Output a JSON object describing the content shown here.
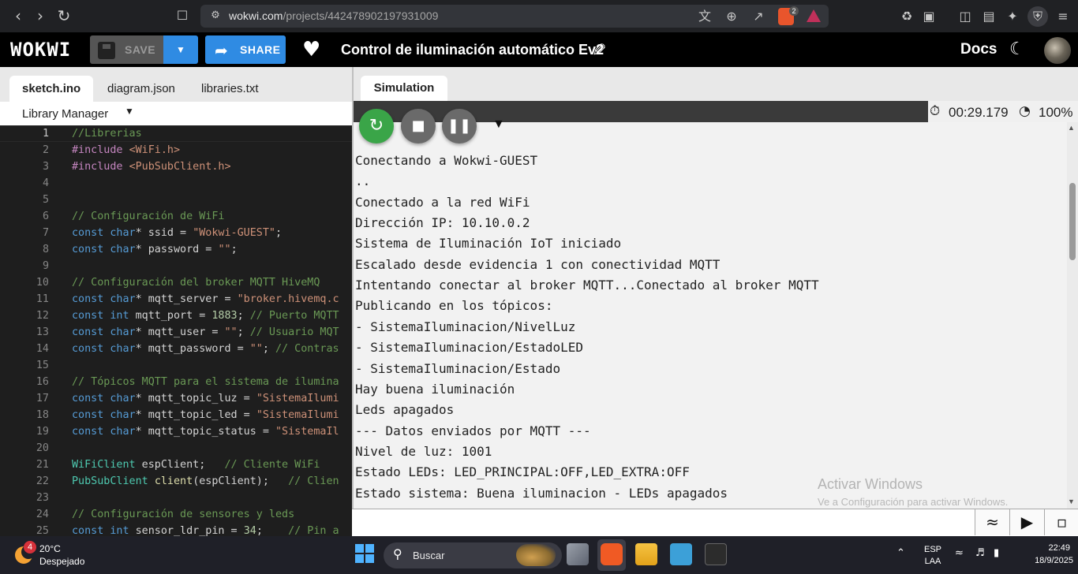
{
  "browser": {
    "url_domain": "wokwi.com",
    "url_path": "/projects/442478902197931009",
    "brave_badge": "2"
  },
  "header": {
    "logo": "WOKWI",
    "save_label": "SAVE",
    "share_label": "SHARE",
    "project_title": "Control de iluminación automático Ev2",
    "docs_label": "Docs"
  },
  "editor_tabs": [
    "sketch.ino",
    "diagram.json",
    "libraries.txt"
  ],
  "library_manager_label": "Library Manager",
  "code_lines": [
    {
      "n": "1",
      "html": "<span class='cm'>//Librerias</span>"
    },
    {
      "n": "2",
      "html": "<span class='inc'>#include</span> <span class='st'>&lt;WiFi.h&gt;</span>"
    },
    {
      "n": "3",
      "html": "<span class='inc'>#include</span> <span class='st'>&lt;PubSubClient.h&gt;</span>"
    },
    {
      "n": "4",
      "html": ""
    },
    {
      "n": "5",
      "html": ""
    },
    {
      "n": "6",
      "html": "<span class='cm'>// Configuración de WiFi</span>"
    },
    {
      "n": "7",
      "html": "<span class='kw'>const</span> <span class='kw'>char</span>* ssid = <span class='st'>\"Wokwi-GUEST\"</span>;"
    },
    {
      "n": "8",
      "html": "<span class='kw'>const</span> <span class='kw'>char</span>* password = <span class='st'>\"\"</span>;"
    },
    {
      "n": "9",
      "html": ""
    },
    {
      "n": "10",
      "html": "<span class='cm'>// Configuración del broker MQTT HiveMQ</span>"
    },
    {
      "n": "11",
      "html": "<span class='kw'>const</span> <span class='kw'>char</span>* mqtt_server = <span class='st'>\"broker.hivemq.c</span>"
    },
    {
      "n": "12",
      "html": "<span class='kw'>const</span> <span class='kw'>int</span> mqtt_port = <span class='nm'>1883</span>; <span class='cm'>// Puerto MQTT</span>"
    },
    {
      "n": "13",
      "html": "<span class='kw'>const</span> <span class='kw'>char</span>* mqtt_user = <span class='st'>\"\"</span>; <span class='cm'>// Usuario MQT</span>"
    },
    {
      "n": "14",
      "html": "<span class='kw'>const</span> <span class='kw'>char</span>* mqtt_password = <span class='st'>\"\"</span>; <span class='cm'>// Contras</span>"
    },
    {
      "n": "15",
      "html": ""
    },
    {
      "n": "16",
      "html": "<span class='cm'>// Tópicos MQTT para el sistema de ilumina</span>"
    },
    {
      "n": "17",
      "html": "<span class='kw'>const</span> <span class='kw'>char</span>* mqtt_topic_luz = <span class='st'>\"SistemaIlumi</span>"
    },
    {
      "n": "18",
      "html": "<span class='kw'>const</span> <span class='kw'>char</span>* mqtt_topic_led = <span class='st'>\"SistemaIlumi</span>"
    },
    {
      "n": "19",
      "html": "<span class='kw'>const</span> <span class='kw'>char</span>* mqtt_topic_status = <span class='st'>\"SistemaIl</span>"
    },
    {
      "n": "20",
      "html": ""
    },
    {
      "n": "21",
      "html": "<span class='ty'>WiFiClient</span> espClient;   <span class='cm'>// Cliente WiFi</span>"
    },
    {
      "n": "22",
      "html": "<span class='ty'>PubSubClient</span> <span class='fn'>client</span>(espClient);   <span class='cm'>// Clien</span>"
    },
    {
      "n": "23",
      "html": ""
    },
    {
      "n": "24",
      "html": "<span class='cm'>// Configuración de sensores y leds</span>"
    },
    {
      "n": "25",
      "html": "<span class='kw'>const</span> <span class='kw'>int</span> sensor_ldr_pin = <span class='nm'>34</span>;    <span class='cm'>// Pin a</span>"
    }
  ],
  "simulation": {
    "tab_label": "Simulation",
    "timer": "00:29.179",
    "speed": "100%",
    "serial_lines": [
      "Conectando a Wokwi-GUEST",
      "..",
      "Conectado a la red WiFi",
      "Dirección IP: 10.10.0.2",
      "Sistema de Iluminación IoT iniciado",
      "Escalado desde evidencia 1 con conectividad MQTT",
      "Intentando conectar al broker MQTT...Conectado al broker MQTT",
      "Publicando en los tópicos:",
      "- SistemaIluminacion/NivelLuz",
      "- SistemaIluminacion/EstadoLED",
      "- SistemaIluminacion/Estado",
      "Hay buena iluminación",
      "Leds apagados",
      "--- Datos enviados por MQTT ---",
      "Nivel de luz: 1001",
      "Estado LEDs: LED_PRINCIPAL:OFF,LED_EXTRA:OFF",
      "Estado sistema: Buena iluminacion - LEDs apagados"
    ],
    "serial_input_value": ""
  },
  "watermark": {
    "line1": "Activar Windows",
    "line2": "Ve a Configuración para activar Windows."
  },
  "taskbar": {
    "weather_badge": "4",
    "weather_temp": "20°C",
    "weather_desc": "Despejado",
    "search_placeholder": "Buscar",
    "lang_top": "ESP",
    "lang_bottom": "LAA",
    "time": "22:49",
    "date": "18/9/2025"
  },
  "colors": {
    "accent_blue": "#2f8be3",
    "run_green": "#3aa548",
    "editor_bg": "#1e1e1e"
  }
}
